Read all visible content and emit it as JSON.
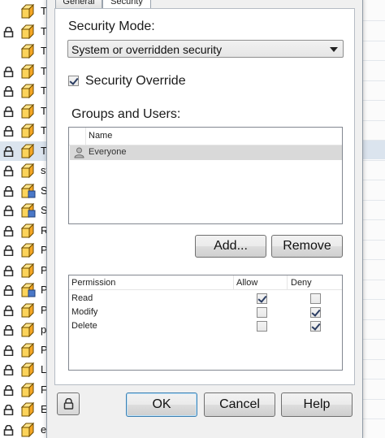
{
  "background_tree": {
    "rows": [
      {
        "label": "T",
        "lock": false
      },
      {
        "label": "T",
        "lock": true
      },
      {
        "label": "T",
        "lock": false
      },
      {
        "label": "T",
        "lock": true
      },
      {
        "label": "T",
        "lock": true
      },
      {
        "label": "T",
        "lock": true
      },
      {
        "label": "T",
        "lock": true
      },
      {
        "label": "T",
        "lock": true,
        "selected": true
      },
      {
        "label": "st",
        "lock": true
      },
      {
        "label": "Se",
        "lock": true
      },
      {
        "label": "Se",
        "lock": true
      },
      {
        "label": "Re",
        "lock": true
      },
      {
        "label": "Pr",
        "lock": true
      },
      {
        "label": "Pr",
        "lock": true
      },
      {
        "label": "Pr",
        "lock": true
      },
      {
        "label": "Pr",
        "lock": true
      },
      {
        "label": "pr",
        "lock": true
      },
      {
        "label": "Pr",
        "lock": true
      },
      {
        "label": "Lo",
        "lock": true
      },
      {
        "label": "Fi",
        "lock": true
      },
      {
        "label": "Er",
        "lock": true
      },
      {
        "label": "er",
        "lock": true
      }
    ]
  },
  "dialog": {
    "tabs": [
      {
        "label": "General",
        "active": false
      },
      {
        "label": "Security",
        "active": true
      }
    ],
    "security_mode": {
      "label": "Security Mode:",
      "selected": "System or overridden security"
    },
    "security_override": {
      "label": "Security Override",
      "checked": true
    },
    "groups": {
      "label": "Groups and Users:",
      "column": "Name",
      "items": [
        {
          "name": "Everyone",
          "selected": true
        }
      ]
    },
    "add_button": "Add...",
    "remove_button": "Remove",
    "permissions": {
      "headers": {
        "permission": "Permission",
        "allow": "Allow",
        "deny": "Deny"
      },
      "rows": [
        {
          "name": "Read",
          "allow": true,
          "deny": false
        },
        {
          "name": "Modify",
          "allow": false,
          "deny": true
        },
        {
          "name": "Delete",
          "allow": false,
          "deny": true
        }
      ]
    },
    "ok_button": "OK",
    "cancel_button": "Cancel",
    "help_button": "Help"
  },
  "colors": {
    "selection": "#dbe4ee",
    "list_selection": "#d9d9d9",
    "dialog_bg": "#f0f0f0",
    "lock_color": "#2b2b2b",
    "cube_orange": "#f5a623",
    "cube_blue": "#4a78c8"
  }
}
